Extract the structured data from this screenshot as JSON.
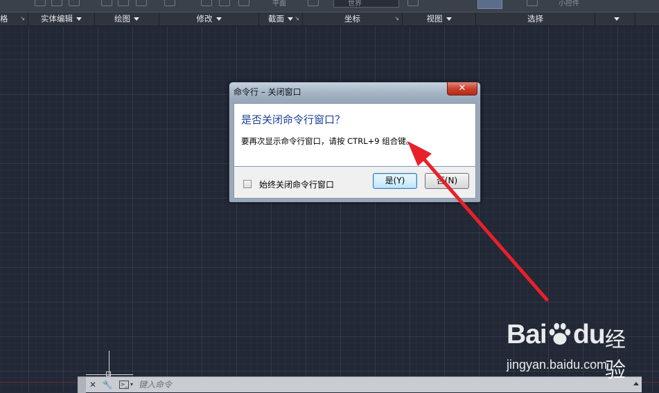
{
  "ribbon": {
    "top_fields": {
      "plane_label": "平面",
      "world_label": "世界",
      "widget_label": "小控件"
    },
    "panels": [
      {
        "label": "格",
        "has_dropdown": false,
        "has_expander": true
      },
      {
        "label": "实体编辑",
        "has_dropdown": true,
        "has_expander": false
      },
      {
        "label": "绘图",
        "has_dropdown": true,
        "has_expander": false
      },
      {
        "label": "修改",
        "has_dropdown": true,
        "has_expander": false
      },
      {
        "label": "截面",
        "has_dropdown": true,
        "has_expander": true
      },
      {
        "label": "坐标",
        "has_dropdown": false,
        "has_expander": true
      },
      {
        "label": "视图",
        "has_dropdown": true,
        "has_expander": false
      },
      {
        "label": "选择",
        "has_dropdown": false,
        "has_expander": false
      },
      {
        "label": "",
        "has_dropdown": true,
        "has_expander": false
      }
    ]
  },
  "dialog": {
    "title": "命令行 – 关闭窗口",
    "close_glyph": "✕",
    "heading": "是否关闭命令行窗口？",
    "message": "要再次显示命令行窗口，请按 CTRL+9 组合键。",
    "checkbox_label": "始终关闭命令行窗口",
    "checkbox_checked": false,
    "yes_label": "是(Y)",
    "no_label": "否(N)"
  },
  "command_line": {
    "close_glyph": "✕",
    "wrench_glyph": "🔧",
    "prompt_glyph": ">_",
    "placeholder": "键入命令"
  },
  "watermark": {
    "logo_text": "Bai",
    "logo_suffix": "du",
    "logo_cn": "经验",
    "url": "jingyan.baidu.com"
  },
  "colors": {
    "canvas": "#222836",
    "arrow": "#e8202a",
    "dialog_heading": "#1b3f9b"
  }
}
